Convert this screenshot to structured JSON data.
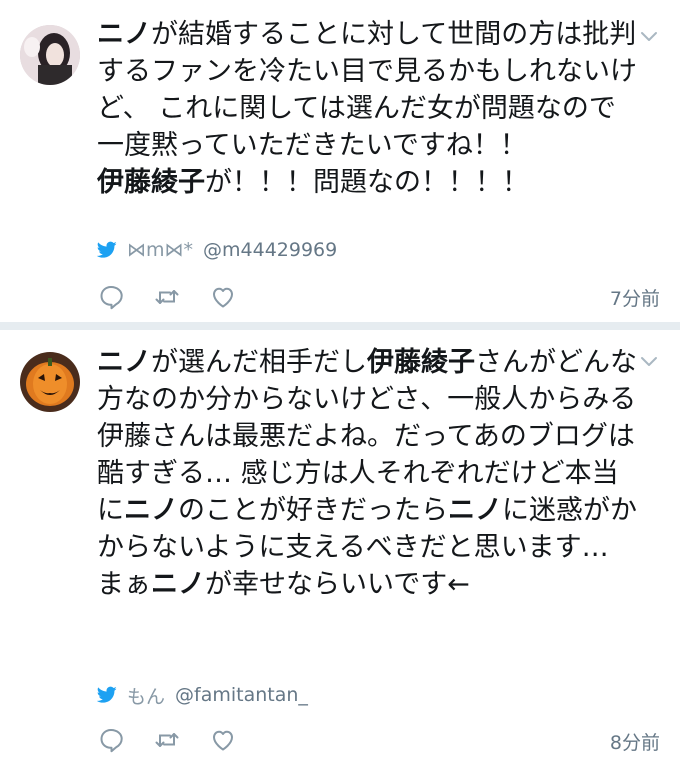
{
  "colors": {
    "text": "#14171a",
    "secondary": "#657786",
    "twitter_blue": "#1da1f2",
    "separator": "#e6ecf0"
  },
  "tweets": [
    {
      "avatar_icon": "avatar-girl-photo",
      "text_segments": [
        {
          "text": "ニノ",
          "bold": true
        },
        {
          "text": "が結婚することに対して世間の方は批判するファンを冷たい目で見るかもしれないけど、 これに関しては選んだ女が問題なので一度黙っていただきたいですね！！\n",
          "bold": false
        },
        {
          "text": "伊藤綾子",
          "bold": true
        },
        {
          "text": "が！！！問題なの！！！！",
          "bold": false
        }
      ],
      "source_icon": "twitter-bird-icon",
      "display_name": "⋈m⋈*",
      "handle": "@m44429969",
      "time": "7分前"
    },
    {
      "avatar_icon": "avatar-pumpkin-photo",
      "text_segments": [
        {
          "text": "ニノ",
          "bold": true
        },
        {
          "text": "が選んだ相手だし",
          "bold": false
        },
        {
          "text": "伊藤綾子",
          "bold": true
        },
        {
          "text": "さんがどんな方なのか分からないけどさ、一般人からみる伊藤さんは最悪だよね。だってあのブログは酷すぎる… 感じ方は人それぞれだけど本当に",
          "bold": false
        },
        {
          "text": "ニノ",
          "bold": true
        },
        {
          "text": "のことが好きだったら",
          "bold": false
        },
        {
          "text": "ニノ",
          "bold": true
        },
        {
          "text": "に迷惑がかからないように支えるべきだと思います… まぁ",
          "bold": false
        },
        {
          "text": "ニノ",
          "bold": true
        },
        {
          "text": "が幸せならいいです←",
          "bold": false
        }
      ],
      "source_icon": "twitter-bird-icon",
      "display_name": "もん",
      "handle": "@famitantan_",
      "time": "8分前"
    }
  ],
  "action_icons": [
    "reply-icon",
    "retweet-icon",
    "like-icon"
  ]
}
